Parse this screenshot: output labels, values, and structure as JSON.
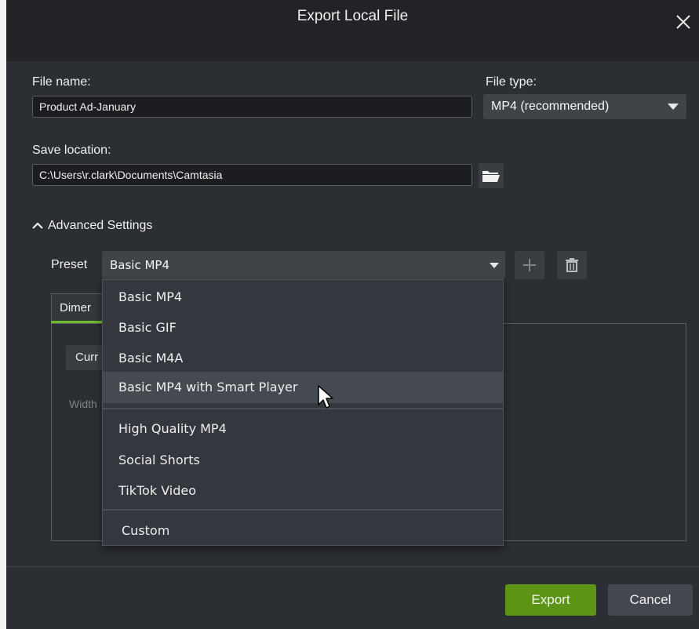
{
  "dialog": {
    "title": "Export Local File"
  },
  "form": {
    "file_name_label": "File name:",
    "file_name_value": "Product Ad-January",
    "file_type_label": "File type:",
    "file_type_value": "MP4 (recommended)",
    "save_location_label": "Save location:",
    "save_location_value": "C:\\Users\\r.clark\\Documents\\Camtasia"
  },
  "advanced": {
    "toggle_label": "Advanced Settings",
    "preset_label": "Preset",
    "preset_value": "Basic MP4",
    "tab_label": "Dimer",
    "curr_label": "Curr",
    "width_label": "Width"
  },
  "preset_menu": {
    "items": [
      {
        "label": "Basic MP4"
      },
      {
        "label": "Basic GIF"
      },
      {
        "label": "Basic M4A"
      },
      {
        "label": "Basic MP4 with Smart Player"
      },
      {
        "label": "High Quality MP4"
      },
      {
        "label": "Social Shorts"
      },
      {
        "label": "TikTok Video"
      },
      {
        "label": "Custom"
      }
    ]
  },
  "footer": {
    "export_label": "Export",
    "cancel_label": "Cancel"
  },
  "colors": {
    "accent": "#5c9416",
    "tab_underline": "#6bbd2a"
  }
}
